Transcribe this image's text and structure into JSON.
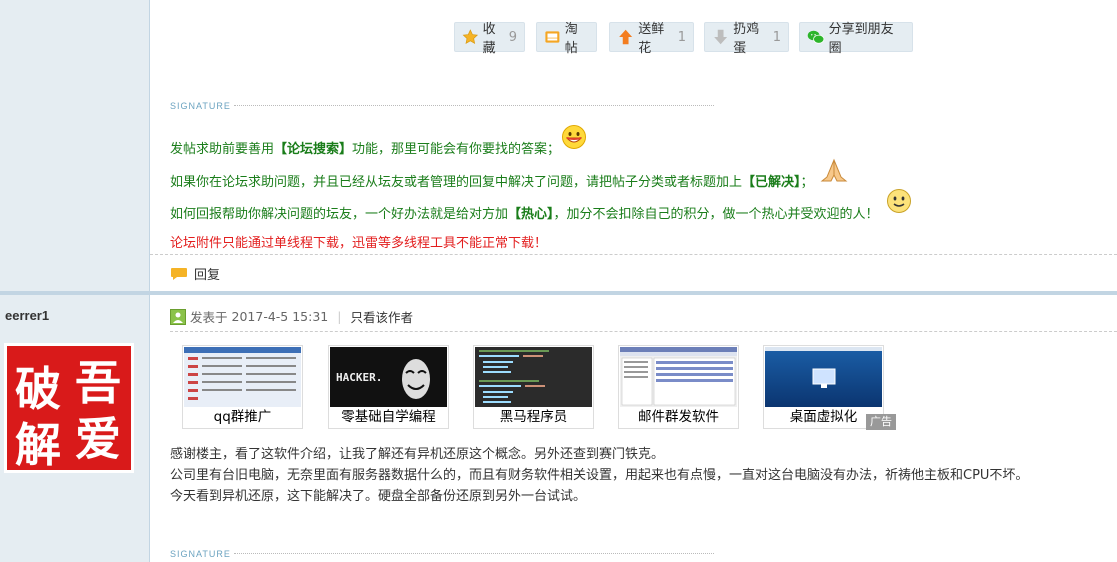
{
  "actions": {
    "favorite": {
      "label": "收藏",
      "count": "9"
    },
    "tao": {
      "label": "淘帖"
    },
    "flower": {
      "label": "送鲜花",
      "count": "1"
    },
    "egg": {
      "label": "扔鸡蛋",
      "count": "1"
    },
    "share": {
      "label": "分享到朋友圈"
    }
  },
  "signature_label": "SIGNATURE",
  "tips": {
    "line1_a": "发帖求助前要善用",
    "line1_b": "【论坛搜索】",
    "line1_c": "功能，那里可能会有你要找的答案；",
    "line2_a": "如果你在论坛求助问题，并且已经从坛友或者管理的回复中解决了问题，请把帖子分类或者标题加上",
    "line2_b": "【已解决】",
    "line2_c": "；",
    "line3_a": "如何回报帮助你解决问题的坛友，一个好办法就是给对方加",
    "line3_b": "【热心】",
    "line3_c": "，加分不会扣除自己的积分，做一个热心并受欢迎的人！",
    "line4": "论坛附件只能通过单线程下载，迅雷等多线程工具不能正常下载！"
  },
  "reply_label": "回复",
  "post": {
    "username": "eerrer1",
    "avatar_text": [
      "吾",
      "破",
      "爱",
      "解"
    ],
    "posted_prefix": "发表于",
    "posted_time": "2017-4-5 15:31",
    "only_author": "只看该作者",
    "ads": [
      {
        "caption": "qq群推广"
      },
      {
        "caption": "零基础自学编程",
        "img_text": "HACKER."
      },
      {
        "caption": "黑马程序员"
      },
      {
        "caption": "邮件群发软件"
      },
      {
        "caption": "桌面虚拟化"
      }
    ],
    "ad_tag": "广告",
    "body": [
      "感谢楼主，看了这软件介绍，让我了解还有异机还原这个概念。另外还查到赛门铁克。",
      "公司里有台旧电脑，无奈里面有服务器数据什么的，而且有财务软件相关设置，用起来也有点慢，一直对这台电脑没有办法，祈祷他主板和CPU不坏。",
      "今天看到异机还原，这下能解决了。硬盘全部备份还原到另外一台试试。"
    ]
  },
  "colors": {
    "sidebar_bg": "#E5EDF2",
    "tip_green": "#1A7D1A",
    "tip_red": "#E31E1E",
    "separator": "#C2D5E3"
  }
}
